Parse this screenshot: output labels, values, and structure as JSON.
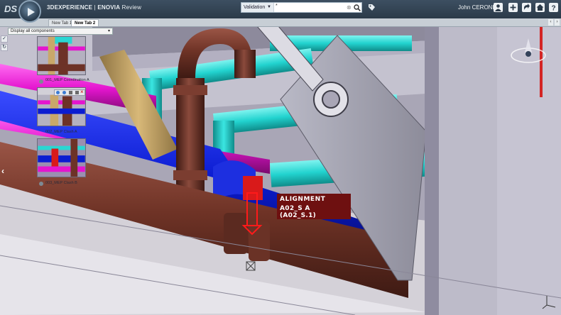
{
  "header": {
    "brand_prefix": "3DEXPERIENCE",
    "separator": " | ",
    "brand_product": "ENOVIA",
    "brand_suffix": " Review",
    "user_name": "John CERONE",
    "icons": [
      "user-icon",
      "add-icon",
      "share-icon",
      "home-icon",
      "help-icon"
    ]
  },
  "search": {
    "scope": "Validation",
    "query": "*",
    "clear_symbol": "⊗"
  },
  "tabs": [
    {
      "label": "New Tab 1",
      "active": false
    },
    {
      "label": "New Tab 2",
      "active": true
    }
  ],
  "tab_nav": {
    "prev": "‹",
    "next": "›"
  },
  "filter": {
    "selected": "Display all components"
  },
  "thumbnails": [
    {
      "label": "001_MEP Coordination A"
    },
    {
      "label": "002_MEP Clash A"
    },
    {
      "label": "003_MEP Clash B"
    }
  ],
  "annotation": {
    "line1": "ALIGNMENT",
    "line2": "A02_S A (A02_S.1)"
  },
  "left_tools": [
    "✓",
    "↻"
  ],
  "collapse_arrow": "‹",
  "colors": {
    "header_bg": "#2b3a49",
    "annotation_bg": "#6e1010",
    "pipe_cyan": "#2ad6d3",
    "pipe_blue": "#0b1cd1",
    "pipe_magenta": "#e415cf",
    "pipe_brown": "#6d3227",
    "pipe_tan": "#c9a86a"
  }
}
